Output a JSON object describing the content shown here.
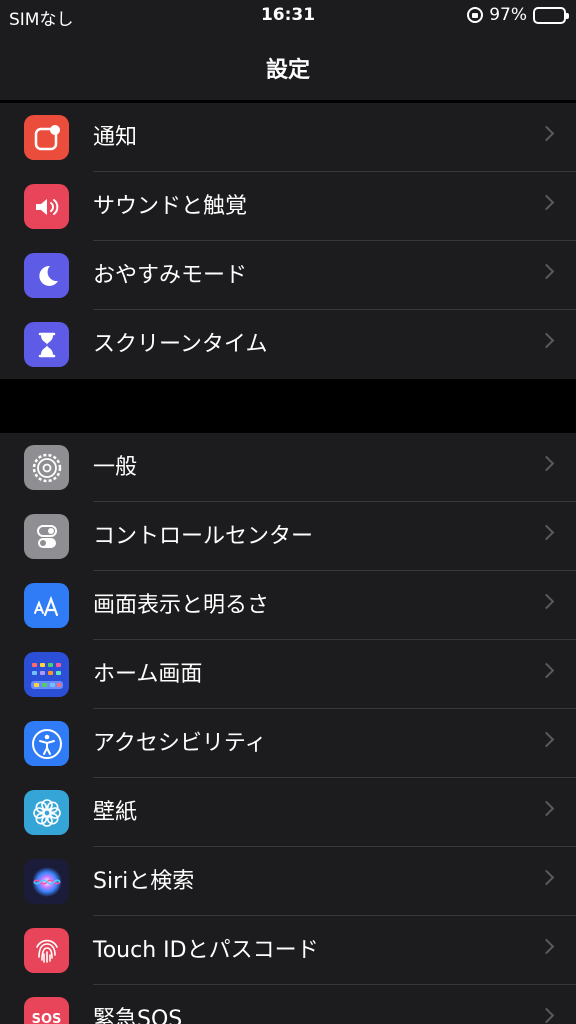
{
  "status_bar": {
    "carrier": "SIMなし",
    "time": "16:31",
    "battery_percent": "97%",
    "battery_level": 0.97
  },
  "nav": {
    "title": "設定"
  },
  "groups": [
    {
      "items": [
        {
          "label": "通知",
          "icon": "notifications-icon",
          "color": "#eb4d3d"
        },
        {
          "label": "サウンドと触覚",
          "icon": "sound-icon",
          "color": "#e9455a"
        },
        {
          "label": "おやすみモード",
          "icon": "moon-icon",
          "color": "#5e5ce6"
        },
        {
          "label": "スクリーンタイム",
          "icon": "hourglass-icon",
          "color": "#5e5ce6"
        }
      ]
    },
    {
      "items": [
        {
          "label": "一般",
          "icon": "gear-icon",
          "color": "#8e8e93"
        },
        {
          "label": "コントロールセンター",
          "icon": "toggles-icon",
          "color": "#8e8e93"
        },
        {
          "label": "画面表示と明るさ",
          "icon": "text-size-icon",
          "color": "#2f7cf6"
        },
        {
          "label": "ホーム画面",
          "icon": "home-screen-grid-icon",
          "color": "#2c4fd8"
        },
        {
          "label": "アクセシビリティ",
          "icon": "accessibility-icon",
          "color": "#2f7cf6"
        },
        {
          "label": "壁紙",
          "icon": "flower-icon",
          "color": "#35a4d6"
        },
        {
          "label": "Siriと検索",
          "icon": "siri-icon",
          "color": "#1b1b3a"
        },
        {
          "label": "Touch IDとパスコード",
          "icon": "fingerprint-icon",
          "color": "#e9455a"
        },
        {
          "label": "緊急SOS",
          "icon": "sos-icon",
          "color": "#e9455a",
          "icon_text": "SOS"
        }
      ]
    }
  ]
}
